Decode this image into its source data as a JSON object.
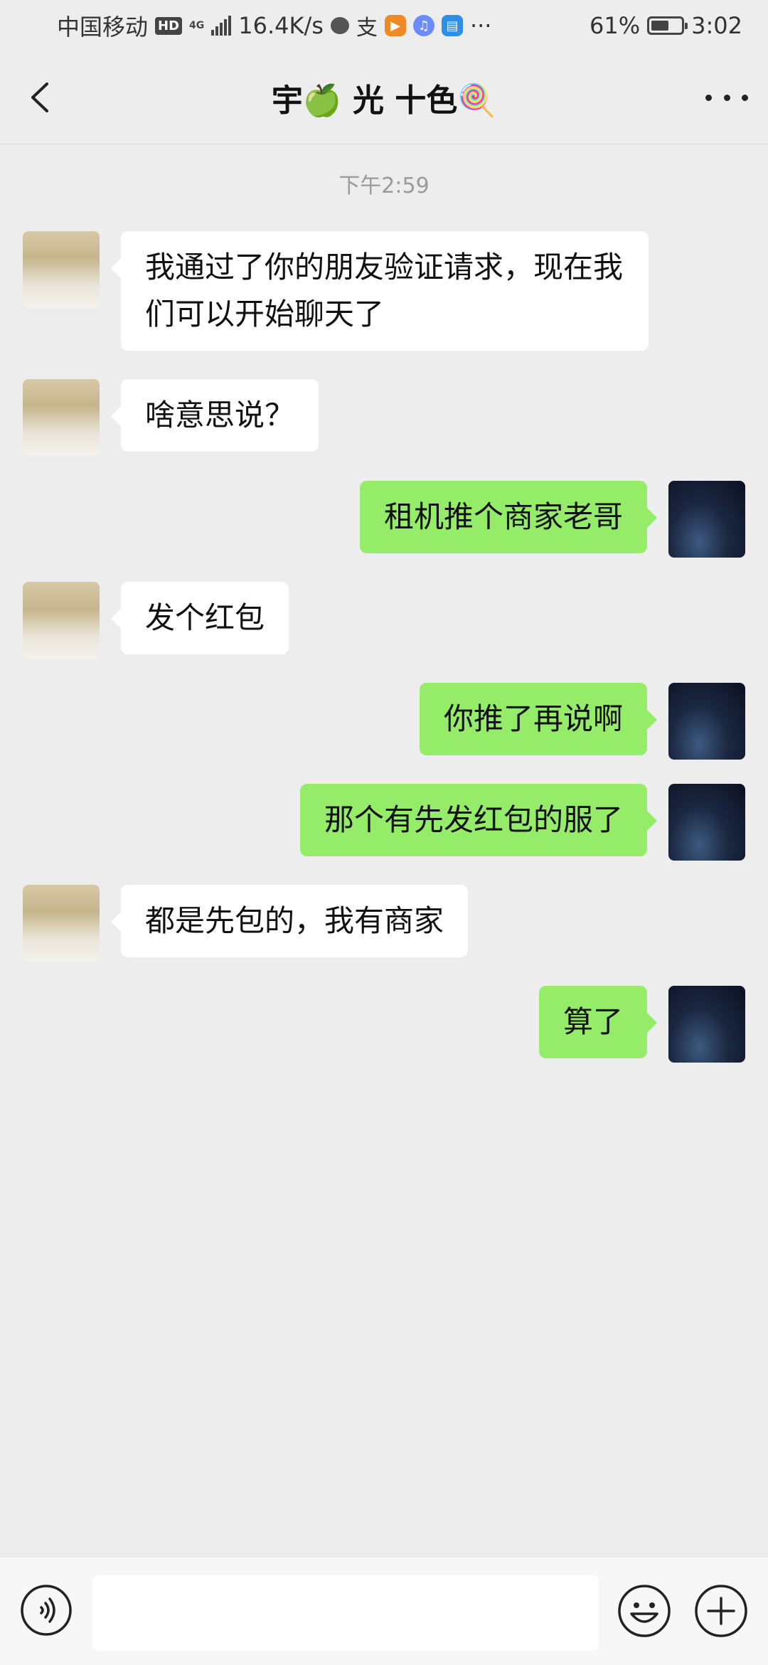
{
  "status_bar": {
    "carrier": "中国移动",
    "hd": "HD",
    "network": "4G",
    "speed": "16.4K/s",
    "more": "···",
    "battery_percent_text": "61%",
    "battery_level": 0.61,
    "time": "3:02",
    "notification_icons": [
      "chat-bubble-icon",
      "alipay-icon",
      "video-app-icon",
      "music-app-icon",
      "wallet-app-icon"
    ]
  },
  "header": {
    "title": "宇🍏 光 十色🍭"
  },
  "chat": {
    "timestamp": "下午2:59",
    "messages": [
      {
        "side": "in",
        "text": "我通过了你的朋友验证请求，现在我们可以开始聊天了"
      },
      {
        "side": "in",
        "text": "啥意思说？"
      },
      {
        "side": "out",
        "text": "租机推个商家老哥"
      },
      {
        "side": "in",
        "text": "发个红包"
      },
      {
        "side": "out",
        "text": "你推了再说啊"
      },
      {
        "side": "out",
        "text": "那个有先发红包的服了"
      },
      {
        "side": "in",
        "text": "都是先包的，我有商家"
      },
      {
        "side": "out",
        "text": "算了"
      }
    ]
  },
  "input": {
    "value": "",
    "placeholder": ""
  },
  "colors": {
    "background": "#ededed",
    "incoming_bubble": "#ffffff",
    "outgoing_bubble": "#95ec69"
  }
}
